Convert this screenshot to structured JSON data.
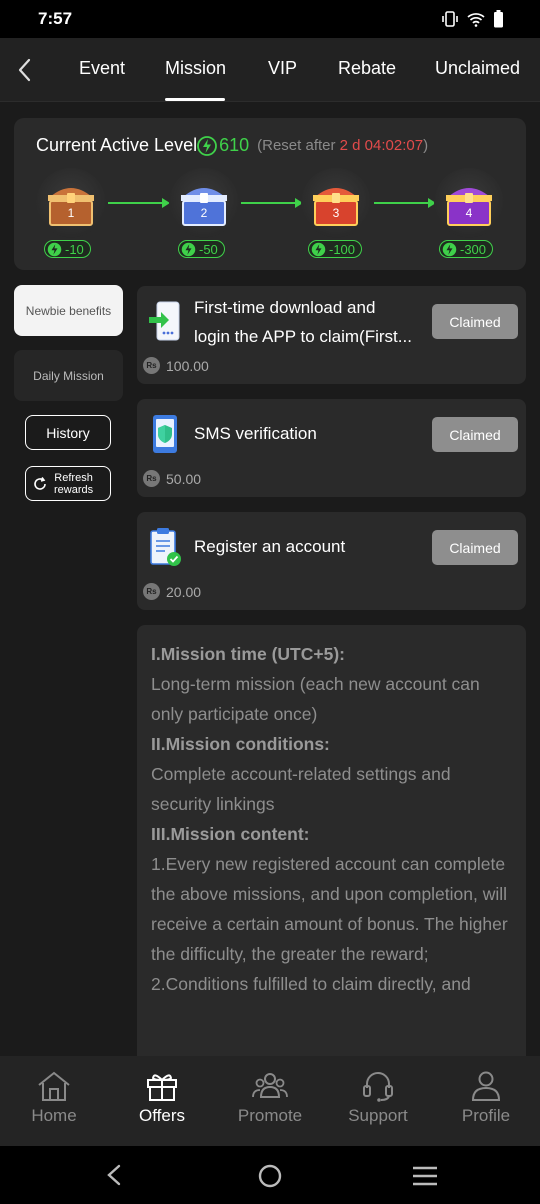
{
  "status_bar": {
    "time": "7:57"
  },
  "tabs": [
    {
      "label": "Event"
    },
    {
      "label": "Mission"
    },
    {
      "label": "VIP"
    },
    {
      "label": "Rebate"
    },
    {
      "label": "Unclaimed"
    }
  ],
  "level": {
    "title": "Current Active Level",
    "value": "610",
    "reset_prefix": "(Reset after ",
    "reset_time": "2 d 04:02:07",
    "reset_suffix": ")",
    "chests": [
      {
        "number": "1",
        "cost": "-10"
      },
      {
        "number": "2",
        "cost": "-50"
      },
      {
        "number": "3",
        "cost": "-100"
      },
      {
        "number": "4",
        "cost": "-300"
      }
    ]
  },
  "side": {
    "newbie": "Newbie benefits",
    "daily": "Daily Mission",
    "history": "History",
    "refresh_line1": "Refresh",
    "refresh_line2": "rewards"
  },
  "missions": [
    {
      "title_line1": "First-time download and",
      "title_line2": "login the APP to claim(First...",
      "button": "Claimed",
      "reward": "100.00"
    },
    {
      "title": "SMS verification",
      "button": "Claimed",
      "reward": "50.00"
    },
    {
      "title": "Register an account",
      "button": "Claimed",
      "reward": "20.00"
    }
  ],
  "currency_symbol": "Rs",
  "rules": {
    "h1": "I.Mission time (UTC+5):",
    "p1": "Long-term mission (each new account can only participate once)",
    "h2": "II.Mission conditions:",
    "p2": "Complete account-related settings and security linkings",
    "h3": "III.Mission content:",
    "p3": "1.Every new registered account can complete the above missions, and upon completion, will receive a certain amount of bonus. The higher the difficulty, the greater the reward;",
    "p4": "2.Conditions fulfilled to claim directly, and"
  },
  "bottom_nav": [
    {
      "label": "Home"
    },
    {
      "label": "Offers"
    },
    {
      "label": "Promote"
    },
    {
      "label": "Support"
    },
    {
      "label": "Profile"
    }
  ],
  "colors": {
    "accent_green": "#3fd14a",
    "reset_red": "#e24b4b",
    "claimed_gray": "#8e8e8e"
  }
}
